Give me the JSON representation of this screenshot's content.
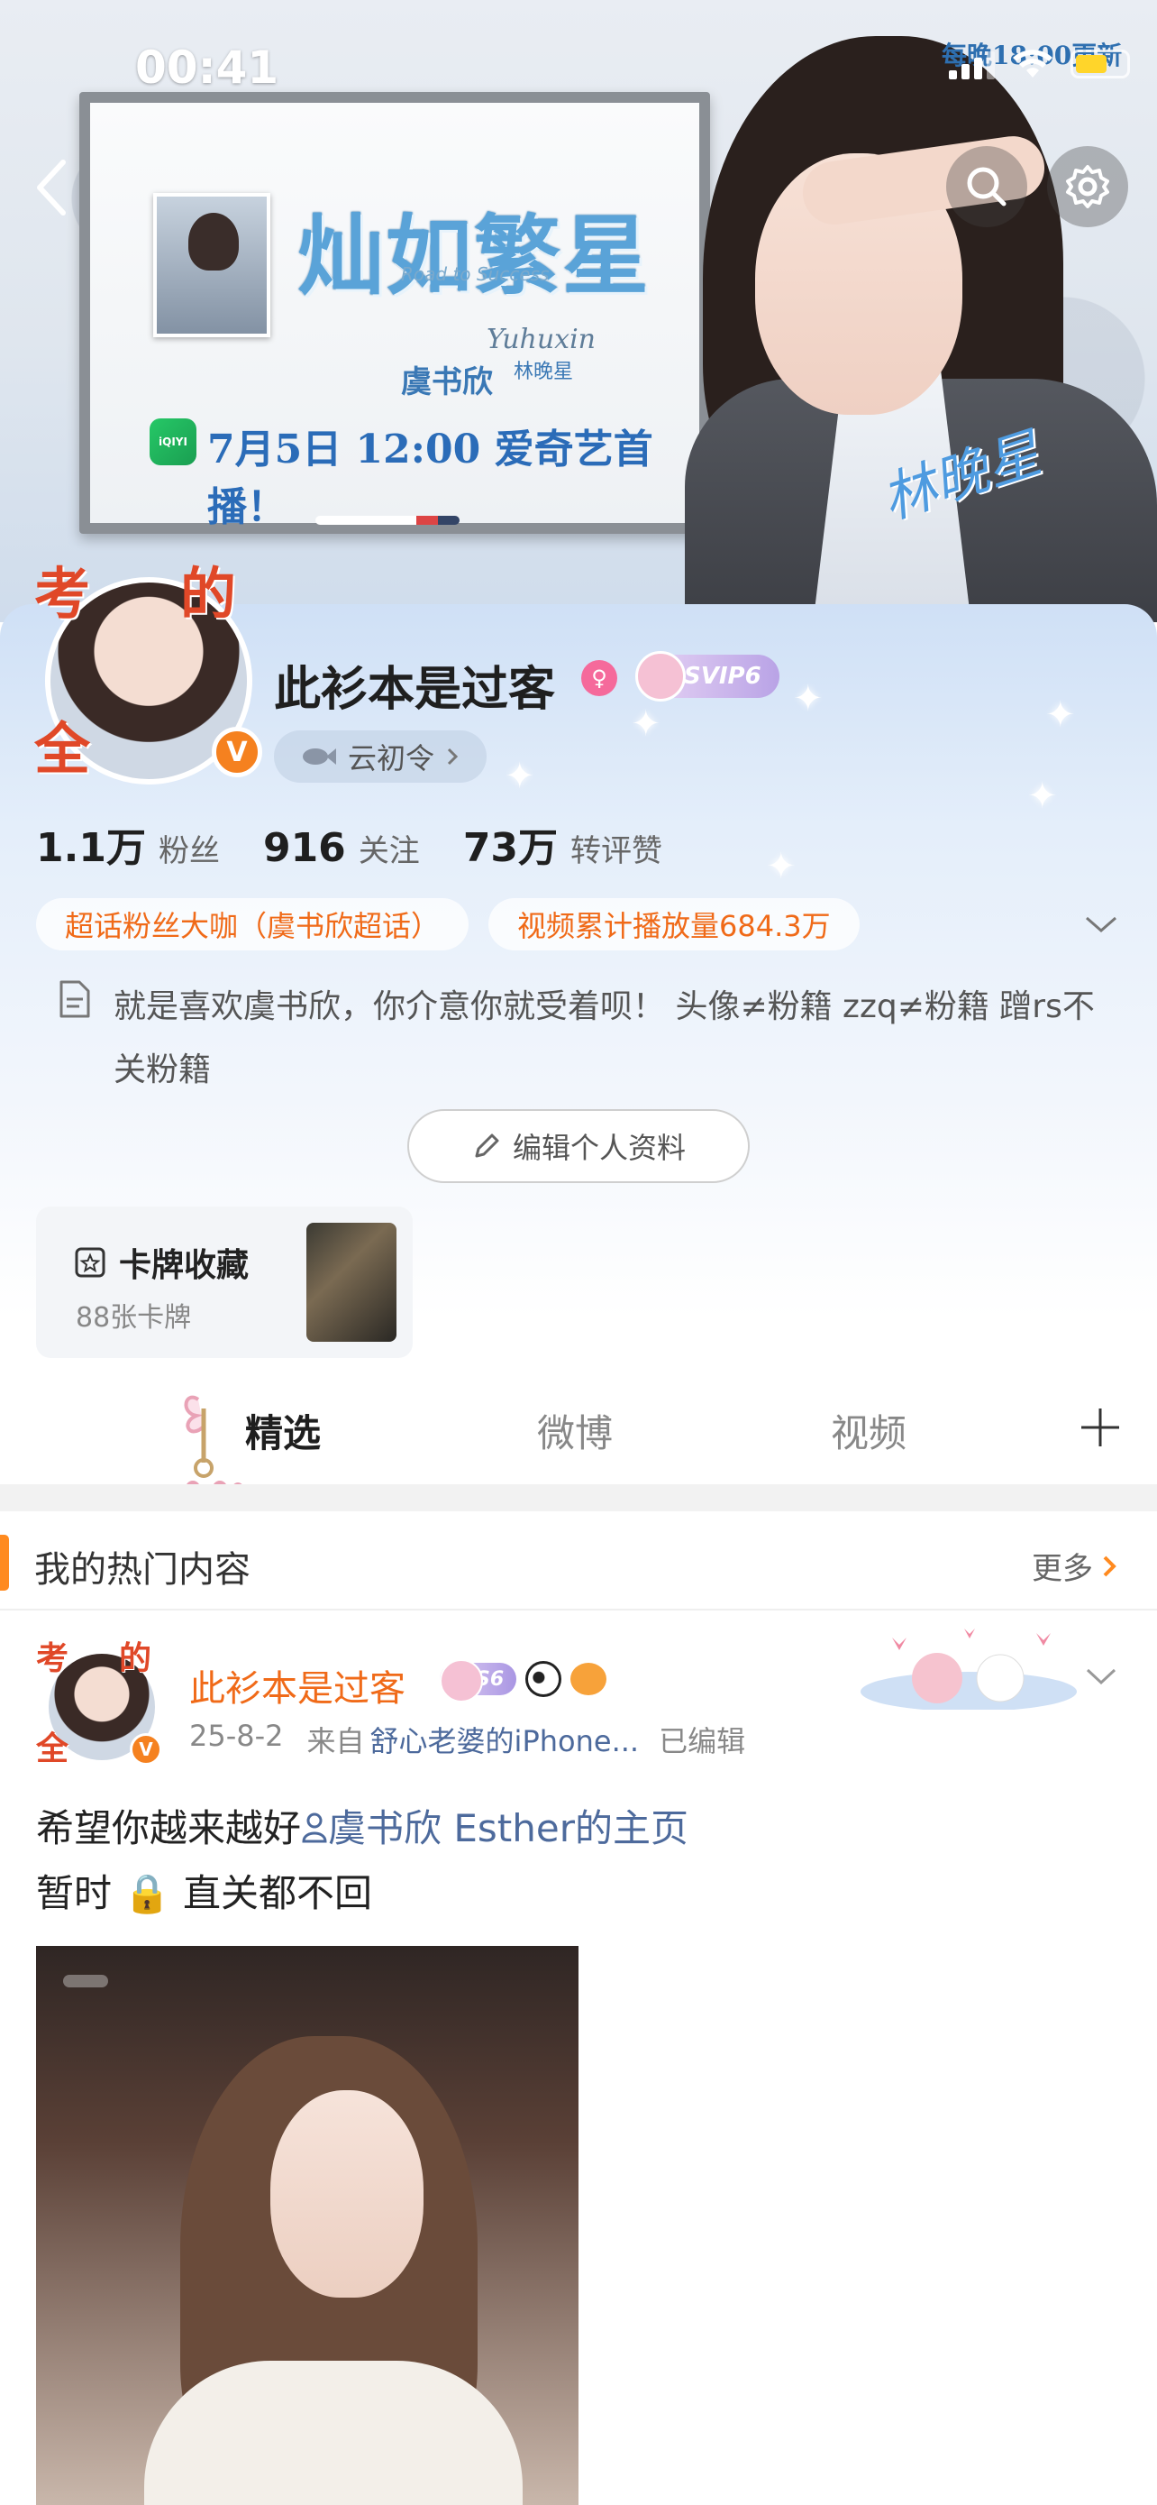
{
  "status_bar": {
    "time": "00:41"
  },
  "banner": {
    "drama_title": "灿如繁星",
    "drama_subtitle": "Road to Success",
    "actor_name": "虞书欣",
    "role_name": "林晚星",
    "signature_script": "Yuhuxin",
    "air_date": "7月5日 12:00 爱奇艺首播！",
    "platform_label": "iQIYI",
    "top_promo": "每晚18:00更新",
    "handwritten_signature": "林晚星"
  },
  "profile": {
    "avatar_frame_chars": [
      "考",
      "的",
      "全"
    ],
    "verified_mark": "V",
    "username": "此衫本是过客",
    "gender_symbol": "♀",
    "vip_badge": "SVIP6",
    "yunling_label": "云初令",
    "stats": [
      {
        "num": "1.1万",
        "label": "粉丝"
      },
      {
        "num": "916",
        "label": "关注"
      },
      {
        "num": "73万",
        "label": "转评赞"
      }
    ],
    "tags": [
      "超话粉丝大咖（虞书欣超话）",
      "视频累计播放量684.3万"
    ],
    "bio": "就是喜欢虞书欣，你介意你就受着呗！ 头像≠粉籍 zzq≠粉籍 蹭rs不关粉籍",
    "edit_button": "编辑个人资料",
    "card_collection": {
      "title": "卡牌收藏",
      "count": "88张卡牌"
    }
  },
  "tabs": {
    "items": [
      "精选",
      "微博",
      "视频"
    ],
    "active": "精选",
    "add_icon": "plus-icon"
  },
  "hot": {
    "title": "我的热门内容",
    "more": "更多"
  },
  "post": {
    "avatar_chars": [
      "考",
      "的",
      "全"
    ],
    "verified_mark": "V",
    "name": "此衫本是过客",
    "level_badge": "S6",
    "date": "25-8-2",
    "from_prefix": "来自",
    "source": "舒心老婆的iPhone...",
    "edited": "已编辑",
    "line1_prefix": "希望你越来越好",
    "line1_link": "虞书欣 Esther的主页",
    "line2": "暂时 🔒 直关都不回"
  },
  "colors": {
    "accent_orange": "#f06a18",
    "link_blue": "#4d6a9c",
    "verified_orange": "#f5811f",
    "svip_purple": "#b9a3e6"
  }
}
